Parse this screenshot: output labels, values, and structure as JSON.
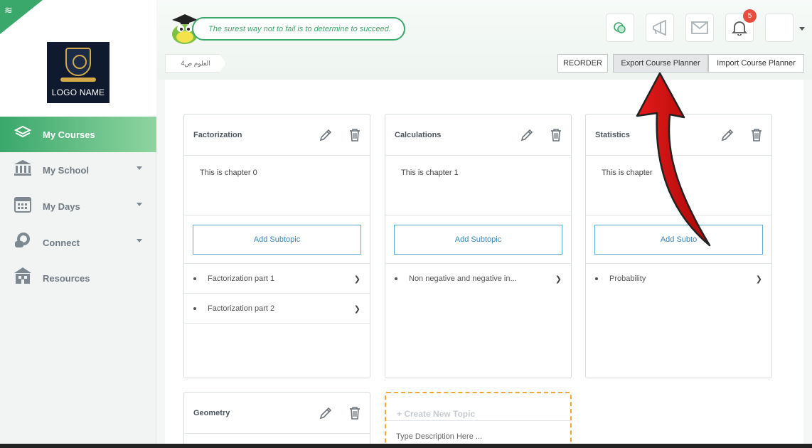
{
  "brand": {
    "logo_text": "LOGO NAME"
  },
  "sidebar": {
    "items": [
      {
        "label": "My Courses",
        "icon": "layers-icon",
        "active": true
      },
      {
        "label": "My School",
        "icon": "bank-icon",
        "has_dropdown": true
      },
      {
        "label": "My Days",
        "icon": "calendar-icon",
        "has_dropdown": true
      },
      {
        "label": "Connect",
        "icon": "chat-bubbles-icon",
        "has_dropdown": true
      },
      {
        "label": "Resources",
        "icon": "building-icon"
      }
    ]
  },
  "header": {
    "quote": "The surest way not to fail is to determine to succeed.",
    "notification_count": "5",
    "icons": [
      "chat-icon",
      "megaphone-icon",
      "mail-icon",
      "bell-icon"
    ]
  },
  "breadcrumb": {
    "label": "العلوم ص4"
  },
  "toolbar": {
    "reorder_label": "REORDER",
    "export_label": "Export Course Planner",
    "import_label": "Import Course Planner"
  },
  "topics": [
    {
      "title": "Factorization",
      "description": "This is chapter 0",
      "add_label": "Add Subtopic",
      "subtopics": [
        "Factorization part 1",
        "Factorization part 2"
      ]
    },
    {
      "title": "Calculations",
      "description": "This is chapter 1",
      "add_label": "Add Subtopic",
      "subtopics": [
        "Non negative and negative in..."
      ]
    },
    {
      "title": "Statistics",
      "description": "This is chapter",
      "add_label": "Add Subto",
      "subtopics": [
        "Probability"
      ]
    },
    {
      "title": "Geometry"
    }
  ],
  "create_topic": {
    "title": "+ Create New Topic",
    "placeholder": "Type Description Here ..."
  },
  "colors": {
    "accent": "#3aa86b",
    "badge": "#e74c3c",
    "add_border": "#5aa9d6",
    "create_border": "#f0a73a",
    "arrow": "#d10e0e"
  }
}
